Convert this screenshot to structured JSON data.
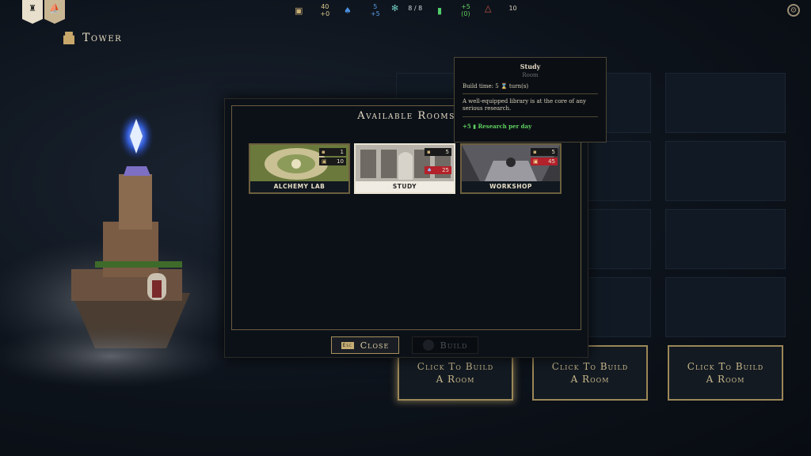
{
  "topbar": {
    "banners": [
      {
        "icon": "tower-icon"
      },
      {
        "icon": "ship-icon"
      }
    ],
    "resources": [
      {
        "icon": "gold-icon",
        "value": "40",
        "delta": "+0"
      },
      {
        "icon": "mana-icon",
        "value": "5",
        "delta": "+5"
      },
      {
        "icon": "population-icon",
        "value": "8 / 8",
        "delta": ""
      },
      {
        "icon": "research-icon",
        "value": "+5",
        "delta": "(0)"
      },
      {
        "icon": "danger-icon",
        "value": "10",
        "delta": ""
      }
    ],
    "settings_icon": "gear-icon"
  },
  "page": {
    "title": "Tower"
  },
  "build_slots": [
    {
      "label": "Click To Build A Room"
    },
    {
      "label": "Click To Build A Room"
    },
    {
      "label": "Click To Build A Room"
    }
  ],
  "modal": {
    "title": "Available Rooms",
    "rooms": [
      {
        "name": "ALCHEMY LAB",
        "costs": [
          {
            "icon": "population-icon",
            "value": "1"
          },
          {
            "icon": "gold-icon",
            "value": "10"
          }
        ]
      },
      {
        "name": "STUDY",
        "costs": [
          {
            "icon": "population-icon",
            "value": "5"
          },
          {
            "icon": "mana-icon",
            "value": "25"
          }
        ]
      },
      {
        "name": "WORKSHOP",
        "costs": [
          {
            "icon": "population-icon",
            "value": "5"
          },
          {
            "icon": "gold-icon",
            "value": "45"
          }
        ]
      }
    ],
    "close_key": "Esc",
    "close_label": "Close",
    "build_label": "Build"
  },
  "tooltip": {
    "title": "Study",
    "subtitle": "Room",
    "build_time_prefix": "Build time: 5",
    "build_time_suffix": "turn(s)",
    "description": "A well-equipped library is at the core of any serious research.",
    "production_value": "+5",
    "production_text": "Research per day"
  },
  "colors": {
    "accent": "#c7a76a",
    "cost_red": "#b3212a",
    "positive": "#5fd05f"
  }
}
